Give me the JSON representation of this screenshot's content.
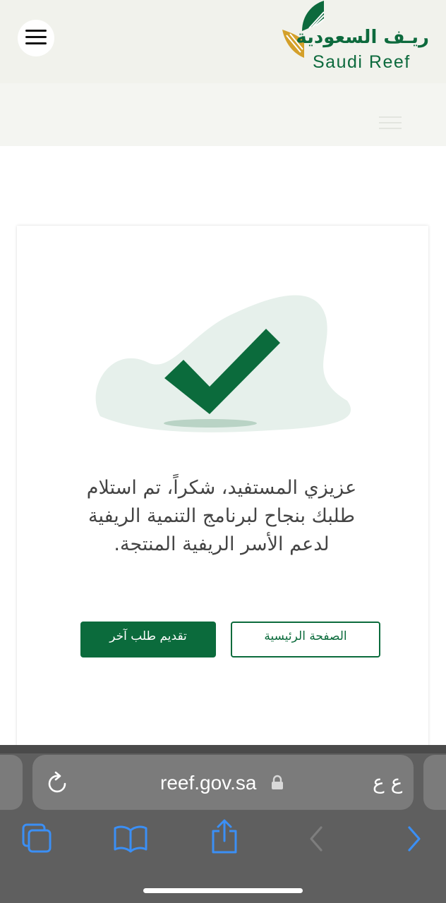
{
  "header": {
    "logo_arabic": "ريـف السعودية",
    "logo_english": "Saudi Reef",
    "brand_green": "#0d6a3d",
    "brand_gold": "#d4a02a",
    "menu_icon": "hamburger-menu-icon"
  },
  "result": {
    "icon": "checkmark-icon",
    "message_lines": [
      "عزيزي المستفيد، شكراً، تم استلام",
      "طلبك بنجاح لبرنامج التنمية الريفية",
      "لدعم الأسر الريفية المنتجة."
    ],
    "submit_another_label": "تقديم طلب آخر",
    "home_label": "الصفحة الرئيسية",
    "primary_color": "#0b6b3c"
  },
  "browser": {
    "url": "reef.gov.sa",
    "lang_label": "ع ع",
    "icons": [
      "reload-icon",
      "lock-icon",
      "tabs-icon",
      "bookmarks-icon",
      "share-icon",
      "back-icon",
      "forward-icon"
    ],
    "accent": "#3b8ff5"
  }
}
